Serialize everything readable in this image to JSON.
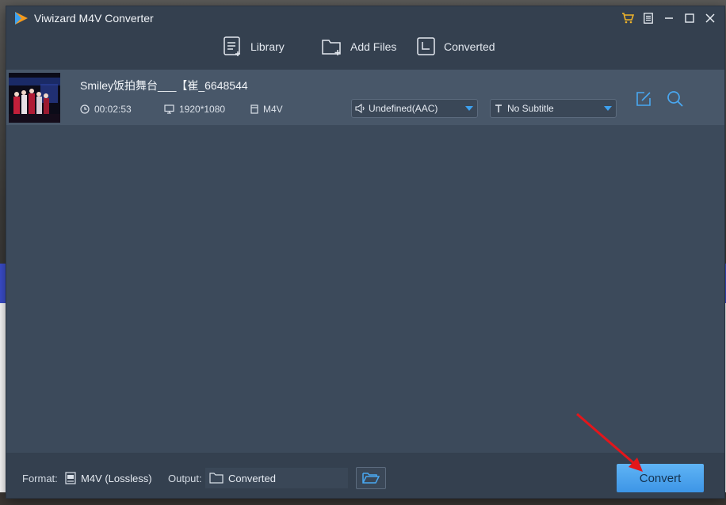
{
  "window": {
    "title": "Viwizard M4V Converter"
  },
  "toolbar": {
    "library_label": "Library",
    "add_files_label": "Add Files",
    "converted_label": "Converted"
  },
  "file": {
    "title": "Smiley饭拍舞台___【崔_6648544",
    "duration": "00:02:53",
    "resolution": "1920*1080",
    "format": "M4V",
    "audio_track": "Undefined(AAC)",
    "subtitle": "No Subtitle"
  },
  "bottombar": {
    "format_label": "Format:",
    "format_value": "M4V (Lossless)",
    "output_label": "Output:",
    "output_value": "Converted",
    "convert_label": "Convert"
  },
  "colors": {
    "accent": "#3d95e6",
    "window_bg": "#3c4a5b",
    "bar_bg": "#34404f",
    "row_bg": "#485769",
    "cart_icon": "#f0b429"
  }
}
